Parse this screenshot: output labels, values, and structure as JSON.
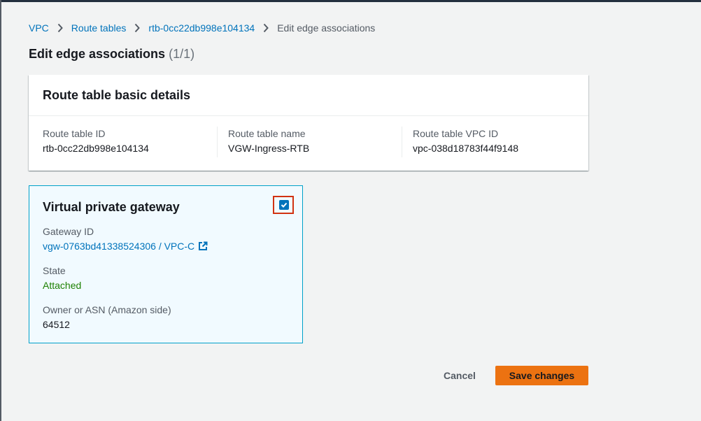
{
  "breadcrumb": {
    "items": [
      {
        "label": "VPC"
      },
      {
        "label": "Route tables"
      },
      {
        "label": "rtb-0cc22db998e104134"
      }
    ],
    "current": "Edit edge associations"
  },
  "page": {
    "title": "Edit edge associations",
    "count": "(1/1)"
  },
  "details": {
    "heading": "Route table basic details",
    "fields": [
      {
        "label": "Route table ID",
        "value": "rtb-0cc22db998e104134"
      },
      {
        "label": "Route table name",
        "value": "VGW-Ingress-RTB"
      },
      {
        "label": "Route table VPC ID",
        "value": "vpc-038d18783f44f9148"
      }
    ]
  },
  "gateway": {
    "title": "Virtual private gateway",
    "checked": true,
    "gateway_id_label": "Gateway ID",
    "gateway_id_value": "vgw-0763bd41338524306 / VPC-C",
    "state_label": "State",
    "state_value": "Attached",
    "owner_label": "Owner or ASN (Amazon side)",
    "owner_value": "64512"
  },
  "actions": {
    "cancel_label": "Cancel",
    "save_label": "Save changes"
  },
  "colors": {
    "link": "#0073bb",
    "primary_button": "#ec7211",
    "selected_border": "#00a1c9",
    "selected_bg": "#f1faff",
    "success": "#1d8102",
    "highlight": "#d13212"
  },
  "icons": {
    "separator": "chevron-right-icon",
    "external_link": "external-link-icon",
    "checkbox": "checkmark-icon"
  }
}
